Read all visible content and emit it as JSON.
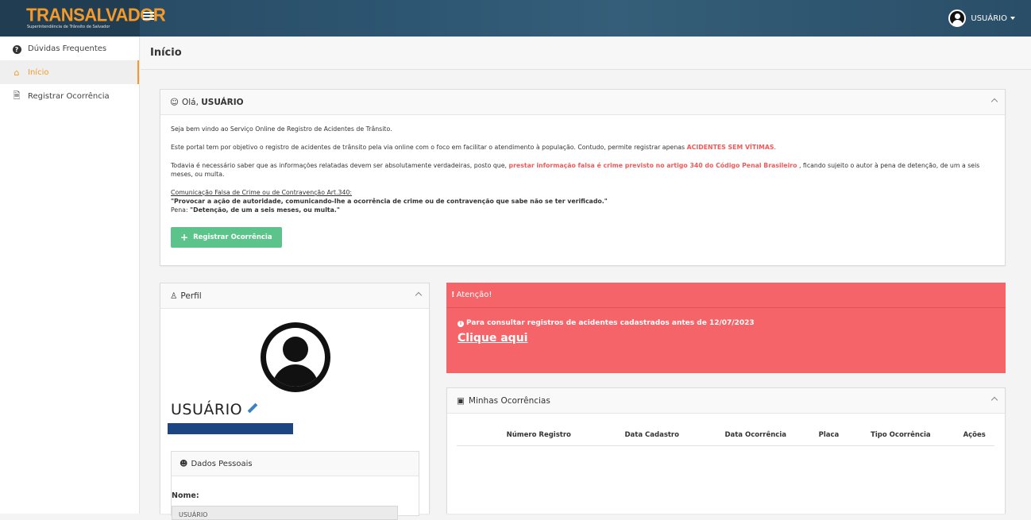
{
  "brand": {
    "title": "TRANSALVADOR",
    "subtitle": "Superintendência de Trânsito de Salvador"
  },
  "topbar": {
    "user_label": "USUÁRIO"
  },
  "sidebar": {
    "items": [
      {
        "label": "Dúvidas Frequentes",
        "icon": "question-circle-icon"
      },
      {
        "label": "Início",
        "icon": "home-icon",
        "active": true
      },
      {
        "label": "Registrar Ocorrência",
        "icon": "document-icon"
      }
    ]
  },
  "page": {
    "title": "Início"
  },
  "welcome": {
    "greeting": "Olá,",
    "user": "USUÁRIO",
    "p1": "Seja bem vindo ao Serviço Online de Registro de Acidentes de Trânsito.",
    "p2_start": "Este portal tem por objetivo o registro de acidentes de trânsito pela via online com o foco em facilitar o atendimento à população. Contudo, permite registrar apenas ",
    "p2_highlight": "ACIDENTES SEM VÍTIMAS",
    "p2_end": ".",
    "p3_start": "Todavia é necessário saber que as informações relatadas devem ser absolutamente verdadeiras, posto que, ",
    "p3_highlight": "prestar informação falsa é crime previsto no artigo 340 do Código Penal Brasileiro",
    "p3_end": " , ficando sujeito o autor à pena de detenção, de um a seis meses, ou multa.",
    "law_title": "Comunicação Falsa de Crime ou de Contravenção Art.340:",
    "law_quote": "\"Provocar a ação de autoridade, comunicando-lhe a ocorrência de crime ou de contravenção que sabe não se ter verificado.\"",
    "penalty_label": "Pena: ",
    "penalty_text": "\"Detenção, de um a seis meses, ou multa.\"",
    "register_button": "Registrar Ocorrência"
  },
  "perfil": {
    "title": "Perfil",
    "name": "USUÁRIO",
    "dados_title": "Dados Pessoais",
    "nome_label": "Nome:",
    "nome_value": "USUÁRIO"
  },
  "atencao": {
    "title": "Atenção!",
    "message": "Para consultar registros de acidentes cadastrados antes de ",
    "date": "12/07/2023",
    "link": "Clique aqui"
  },
  "ocorrencias": {
    "title": "Minhas Ocorrências",
    "columns": [
      "Número Registro",
      "Data Cadastro",
      "Data Ocorrência",
      "Placa",
      "Tipo Ocorrência",
      "Ações"
    ]
  },
  "colors": {
    "brand_orange": "#f39a2b",
    "alert_red": "#f56468",
    "success_green": "#5cc48a",
    "topbar_blue": "#2d5672"
  }
}
